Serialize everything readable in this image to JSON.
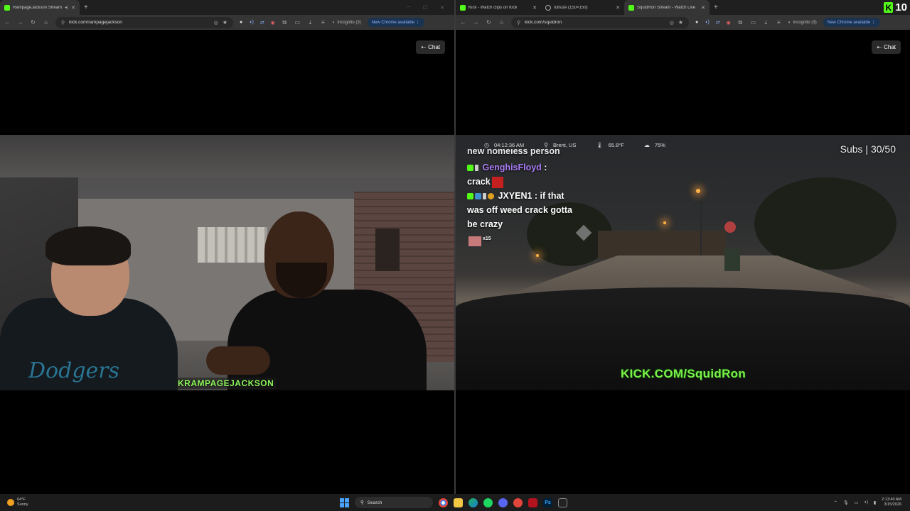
{
  "left_window": {
    "tab": {
      "title": "RampageJackson Stream"
    },
    "address": "kick.com/rampagejackson",
    "incognito_label": "Incognito (3)",
    "new_chrome_label": "New Chrome available",
    "chat_button": "Chat",
    "video": {
      "overlay_tag": "KRAMPAGEJACKSON",
      "shirt_text": "Dodgers"
    }
  },
  "right_window": {
    "tabs": [
      {
        "title": "Kick - Watch clips on Kick"
      },
      {
        "title": "fullsize (150×150)"
      },
      {
        "title": "SquidRon Stream - Watch Live"
      }
    ],
    "kick_counter": "10",
    "address": "kick.com/squidron",
    "incognito_label": "Incognito (3)",
    "new_chrome_label": "New Chrome available",
    "chat_button": "Chat",
    "video": {
      "stats": {
        "time": "04:12:36 AM",
        "location": "Brent, US",
        "temp": "65.8°F",
        "humidity": "75%"
      },
      "subs": "Subs | 30/50",
      "chat": {
        "cutoff_line": "new homeless person",
        "msg1_user": "GenghisFloyd",
        "msg1_text": "crack",
        "msg2_user": "JXYEN1",
        "msg2_text": "if that was off weed crack gotta be crazy",
        "emote_count": "x15"
      },
      "watermark": "KICK.COM/SquidRon"
    }
  },
  "taskbar": {
    "weather_temp": "64°F",
    "weather_desc": "Sunny",
    "search_label": "Search",
    "time": "2:13:40 AM",
    "date": "3/15/2026"
  },
  "colors": {
    "kick_green": "#53fc18",
    "chat_purple": "#a97cf2"
  }
}
